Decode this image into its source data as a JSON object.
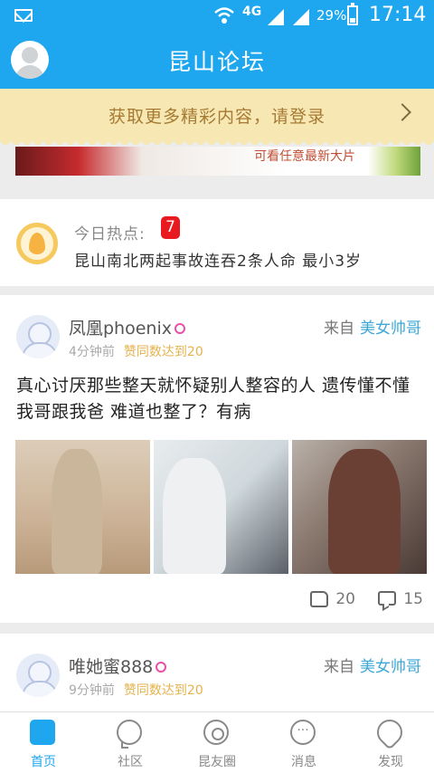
{
  "status_bar": {
    "network": "4G",
    "battery": "29%",
    "time": "17:14"
  },
  "header": {
    "title": "昆山论坛"
  },
  "login_banner": {
    "text": "获取更多精彩内容，请登录"
  },
  "ad_banner": {
    "text": "可看任意最新大片"
  },
  "hot_topic": {
    "label": "今日热点:",
    "count": "7",
    "headline": "昆山南北两起事故连吞2条人命 最小3岁"
  },
  "posts": [
    {
      "author": "凤凰phoenix",
      "time": "4分钟前",
      "award": "赞同数达到20",
      "from_label": "来自",
      "section": "美女帅哥",
      "text": "真心讨厌那些整天就怀疑别人整容的人 遗传懂不懂 我哥跟我爸 难道也整了？有病",
      "images": 3,
      "likes": "20",
      "comments": "15"
    },
    {
      "author": "唯她蜜888",
      "time": "9分钟前",
      "award": "赞同数达到20",
      "from_label": "来自",
      "section": "美女帅哥"
    }
  ],
  "tabs": [
    {
      "label": "首页",
      "icon": "chat-bubbles-icon",
      "active": true
    },
    {
      "label": "社区",
      "icon": "speech-bubble-icon",
      "active": false
    },
    {
      "label": "昆友圈",
      "icon": "camera-circle-icon",
      "active": false
    },
    {
      "label": "消息",
      "icon": "message-dots-icon",
      "active": false
    },
    {
      "label": "发现",
      "icon": "rocket-icon",
      "active": false
    }
  ],
  "colors": {
    "primary": "#1ea7ef",
    "banner_bg": "#f6e7b3",
    "badge_red": "#e8191f",
    "section_blue": "#3ea7d6",
    "award_gold": "#e6b24d"
  }
}
